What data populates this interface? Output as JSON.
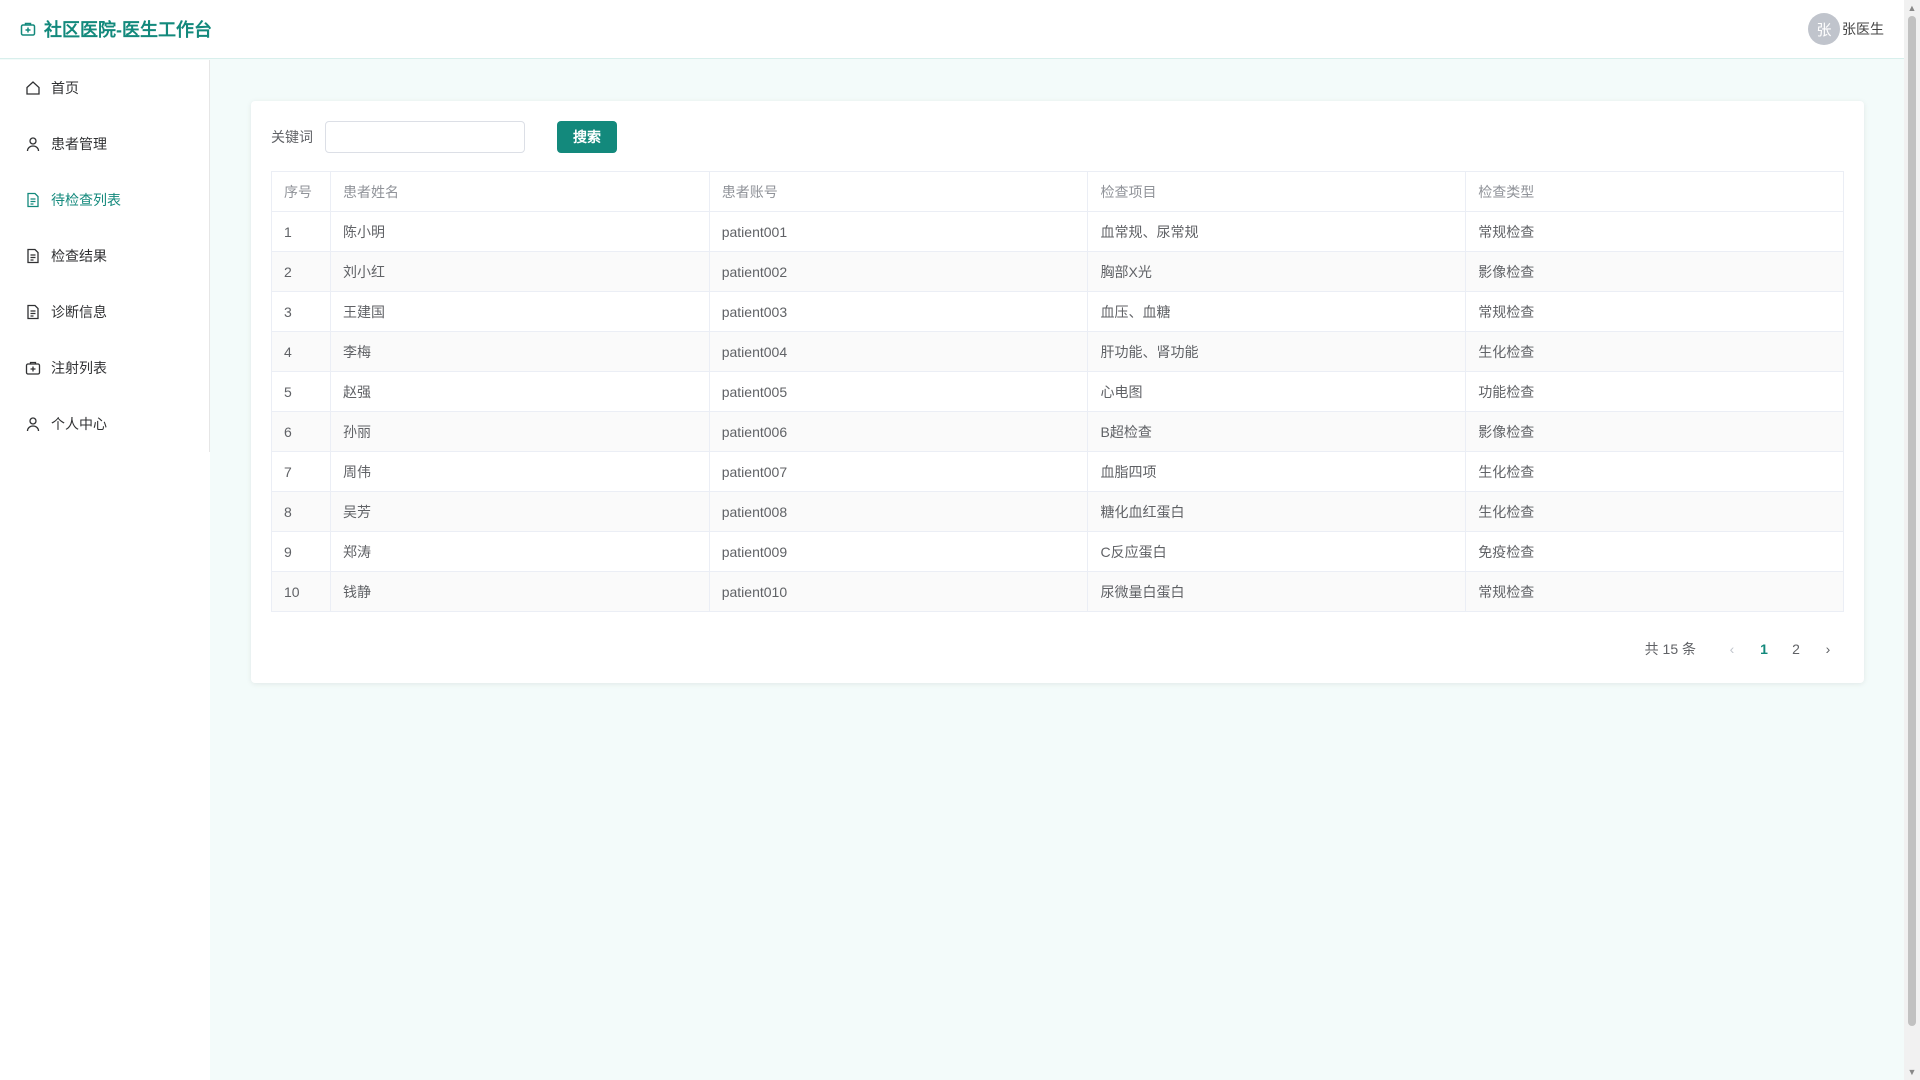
{
  "header": {
    "title": "社区医院-医生工作台",
    "avatar_text": "张",
    "username": "张医生"
  },
  "sidebar": {
    "items": [
      {
        "label": "首页",
        "icon": "home-icon"
      },
      {
        "label": "患者管理",
        "icon": "user-icon"
      },
      {
        "label": "待检查列表",
        "icon": "document-icon",
        "active": true
      },
      {
        "label": "检查结果",
        "icon": "document-icon"
      },
      {
        "label": "诊断信息",
        "icon": "document-icon"
      },
      {
        "label": "注射列表",
        "icon": "first-aid-kit-icon"
      },
      {
        "label": "个人中心",
        "icon": "user-icon"
      }
    ]
  },
  "search": {
    "label": "关键词",
    "value": "",
    "placeholder": "",
    "button_label": "搜索"
  },
  "table": {
    "columns": [
      "序号",
      "患者姓名",
      "患者账号",
      "检查项目",
      "检查类型"
    ],
    "rows": [
      [
        "1",
        "陈小明",
        "patient001",
        "血常规、尿常规",
        "常规检查"
      ],
      [
        "2",
        "刘小红",
        "patient002",
        "胸部X光",
        "影像检查"
      ],
      [
        "3",
        "王建国",
        "patient003",
        "血压、血糖",
        "常规检查"
      ],
      [
        "4",
        "李梅",
        "patient004",
        "肝功能、肾功能",
        "生化检查"
      ],
      [
        "5",
        "赵强",
        "patient005",
        "心电图",
        "功能检查"
      ],
      [
        "6",
        "孙丽",
        "patient006",
        "B超检查",
        "影像检查"
      ],
      [
        "7",
        "周伟",
        "patient007",
        "血脂四项",
        "生化检查"
      ],
      [
        "8",
        "吴芳",
        "patient008",
        "糖化血红蛋白",
        "生化检查"
      ],
      [
        "9",
        "郑涛",
        "patient009",
        "C反应蛋白",
        "免疫检查"
      ],
      [
        "10",
        "钱静",
        "patient010",
        "尿微量白蛋白",
        "常规检查"
      ]
    ]
  },
  "pagination": {
    "total_text": "共 15 条",
    "pages": [
      "1",
      "2"
    ],
    "current": "1"
  },
  "colors": {
    "accent": "#13897c",
    "background": "#f3fbfa"
  }
}
